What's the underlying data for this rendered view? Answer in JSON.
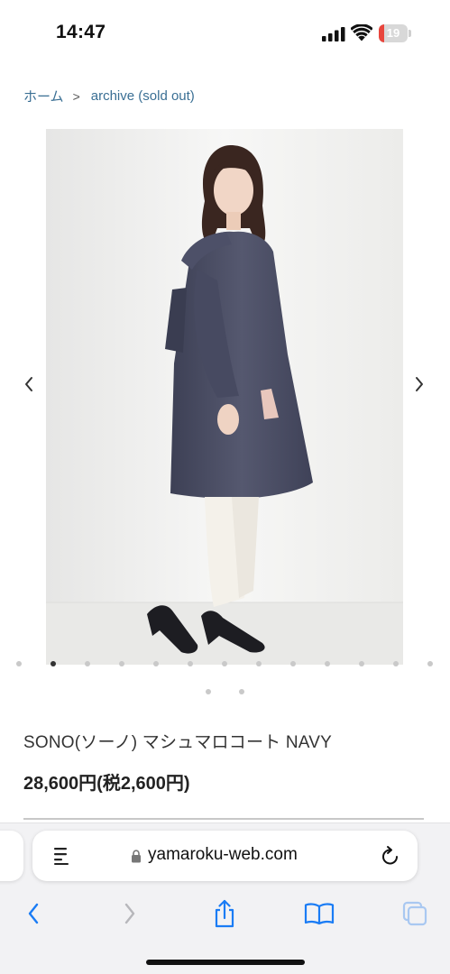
{
  "status_bar": {
    "time": "14:47",
    "battery_level": "19",
    "icons": [
      "signal-icon",
      "wifi-icon",
      "battery-icon"
    ]
  },
  "breadcrumb": {
    "home": "ホーム",
    "separator": ">",
    "current": "archive (sold out)"
  },
  "carousel": {
    "image_alt_icon": "product-photo",
    "prev_icon": "chevron-left-icon",
    "next_icon": "chevron-right-icon",
    "dots_row1_count": 13,
    "dots_row1_active_index": 1,
    "dots_row2_count": 2
  },
  "product": {
    "title": "SONO(ソーノ) マシュマロコート  NAVY",
    "price": "28,600円(税2,600円)"
  },
  "browser": {
    "url": "yamaroku-web.com",
    "toolbar_icons": [
      "back-icon",
      "forward-icon",
      "share-icon",
      "bookmarks-icon",
      "tabs-icon"
    ]
  },
  "colors": {
    "link": "#3a6f94",
    "accent_blue": "#1a7cf5",
    "battery_low": "#e8453c",
    "coat_navy": "#4a4d63"
  }
}
